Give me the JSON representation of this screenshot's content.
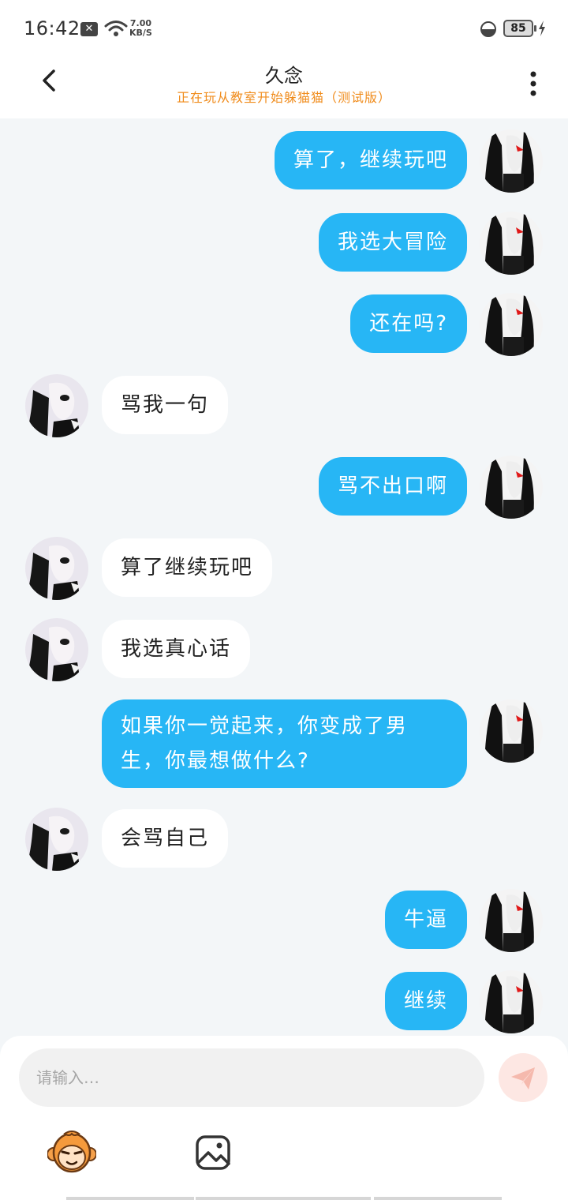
{
  "status_bar": {
    "time": "16:42",
    "speed_value": "7.00",
    "speed_unit": "KB/S",
    "battery": "85"
  },
  "header": {
    "title": "久念",
    "subtitle": "正在玩从教室开始躲猫猫（测试版）",
    "back_icon": "chevron-left-icon",
    "more_icon": "more-vertical-icon"
  },
  "colors": {
    "my_bubble": "#27b6f5",
    "their_bubble": "#ffffff",
    "subtitle": "#f08c1c",
    "background": "#f3f6f8"
  },
  "messages": [
    {
      "from": "me",
      "text": "算了，继续玩吧"
    },
    {
      "from": "me",
      "text": "我选大冒险"
    },
    {
      "from": "me",
      "text": "还在吗?"
    },
    {
      "from": "other",
      "text": "骂我一句"
    },
    {
      "from": "me",
      "text": "骂不出口啊"
    },
    {
      "from": "other",
      "text": "算了继续玩吧"
    },
    {
      "from": "other",
      "text": "我选真心话"
    },
    {
      "from": "me",
      "text_line1": "如果你一觉起来，你变成了男",
      "text_line2": "生，你最想做什么?"
    },
    {
      "from": "other",
      "text": "会骂自己"
    },
    {
      "from": "me",
      "text": "牛逼"
    },
    {
      "from": "me",
      "text": "继续"
    }
  ],
  "input": {
    "placeholder": "请输入…",
    "send_icon": "paper-plane-icon",
    "emoji_icon": "monkey-face-icon",
    "image_icon": "image-icon"
  }
}
